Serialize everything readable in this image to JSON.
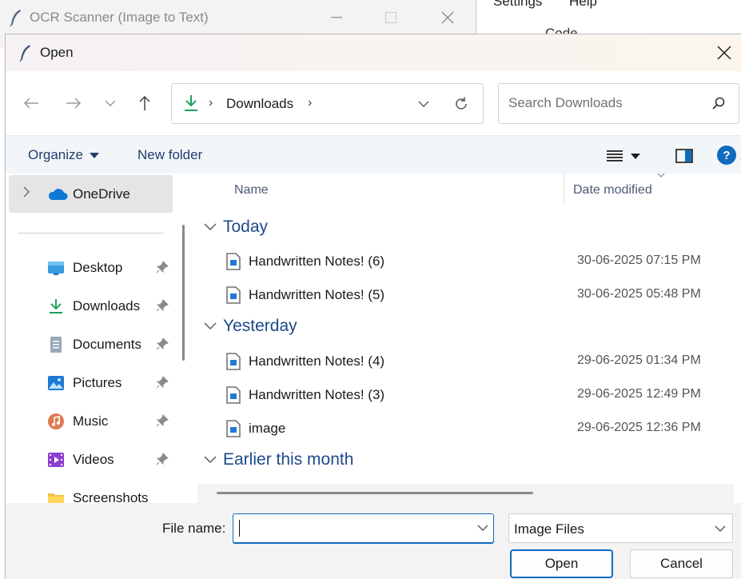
{
  "background_app": {
    "title": "OCR Scanner (Image to Text)",
    "icon": "feather-icon",
    "menu_partial": [
      "Settings",
      "Help"
    ],
    "toolbar_partial": "Code",
    "controls": [
      "minimize",
      "maximize",
      "close"
    ]
  },
  "dialog": {
    "title": "Open",
    "icon": "feather-icon",
    "nav": {
      "back_icon": "arrow-left-icon",
      "forward_icon": "arrow-right-icon",
      "recent_icon": "chevron-down-icon",
      "up_icon": "arrow-up-icon"
    },
    "address": {
      "location_icon": "download-icon",
      "crumb": "Downloads"
    },
    "search": {
      "placeholder": "Search Downloads"
    },
    "toolbar": {
      "organize_label": "Organize",
      "new_folder_label": "New folder",
      "help_label": "?"
    },
    "sidebar": {
      "onedrive_label": "OneDrive",
      "items": [
        {
          "label": "Desktop",
          "icon": "desktop-icon",
          "pinned": true
        },
        {
          "label": "Downloads",
          "icon": "download-icon",
          "pinned": true
        },
        {
          "label": "Documents",
          "icon": "document-icon",
          "pinned": true
        },
        {
          "label": "Pictures",
          "icon": "pictures-icon",
          "pinned": true
        },
        {
          "label": "Music",
          "icon": "music-icon",
          "pinned": true
        },
        {
          "label": "Videos",
          "icon": "videos-icon",
          "pinned": true
        },
        {
          "label": "Screenshots",
          "icon": "folder-icon",
          "pinned": false
        }
      ]
    },
    "file_list": {
      "columns": {
        "name": "Name",
        "date": "Date modified"
      },
      "groups": [
        {
          "label": "Today",
          "files": [
            {
              "name": "Handwritten Notes! (6)",
              "date": "30-06-2025 07:15 PM"
            },
            {
              "name": "Handwritten Notes! (5)",
              "date": "30-06-2025 05:48 PM"
            }
          ]
        },
        {
          "label": "Yesterday",
          "files": [
            {
              "name": "Handwritten Notes! (4)",
              "date": "29-06-2025 01:34 PM"
            },
            {
              "name": "Handwritten Notes! (3)",
              "date": "29-06-2025 12:49 PM"
            },
            {
              "name": "image",
              "date": "29-06-2025 12:36 PM"
            }
          ]
        },
        {
          "label": "Earlier this month",
          "files": []
        }
      ]
    },
    "footer": {
      "file_name_label": "File name:",
      "file_name_value": "",
      "file_type_selected": "Image Files",
      "open_label": "Open",
      "cancel_label": "Cancel"
    }
  },
  "colors": {
    "accent": "#0f6cbd",
    "group_header": "#1e4a8a",
    "command_text": "#1d3e6b",
    "download_green": "#1aa260"
  }
}
